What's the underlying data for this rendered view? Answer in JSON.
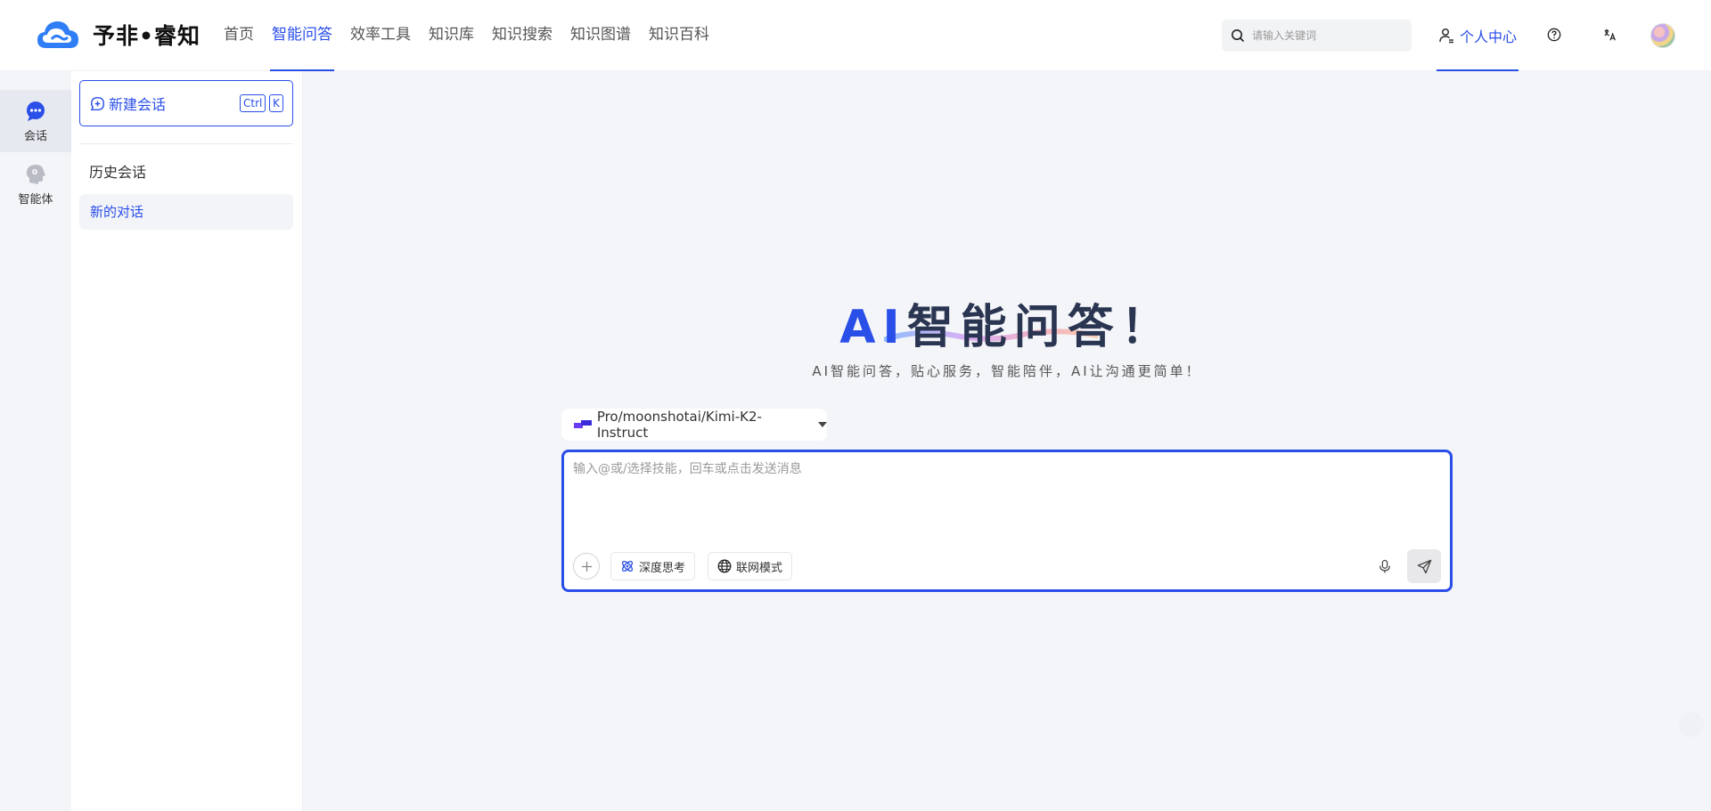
{
  "brand": {
    "name": "予非•睿知",
    "accent": "#2a4ee8"
  },
  "nav": {
    "items": [
      {
        "label": "首页",
        "active": false
      },
      {
        "label": "智能问答",
        "active": true
      },
      {
        "label": "效率工具",
        "active": false
      },
      {
        "label": "知识库",
        "active": false
      },
      {
        "label": "知识搜索",
        "active": false
      },
      {
        "label": "知识图谱",
        "active": false
      },
      {
        "label": "知识百科",
        "active": false
      }
    ]
  },
  "search": {
    "placeholder": "请输入关键词",
    "icon": "search-icon"
  },
  "header": {
    "user_center_label": "个人中心",
    "icons": [
      "help-icon",
      "translate-icon",
      "avatar"
    ]
  },
  "rail": {
    "items": [
      {
        "label": "会话",
        "icon": "chat-bubble-icon",
        "active": true
      },
      {
        "label": "智能体",
        "icon": "agent-head-icon",
        "active": false
      }
    ]
  },
  "panel": {
    "new_chat_label": "新建会话",
    "shortcut": {
      "key1": "Ctrl",
      "key2": "K"
    },
    "history_title": "历史会话",
    "history_items": [
      {
        "label": "新的对话",
        "active": true
      }
    ]
  },
  "hero": {
    "title_ai": "AI",
    "title_rest": "智能问答！",
    "subtitle": "AI智能问答，贴心服务，智能陪伴，AI让沟通更简单！"
  },
  "composer": {
    "model": "Pro/moonshotai/Kimi-K2-Instruct",
    "placeholder": "输入@或/选择技能，回车或点击发送消息",
    "deep_think_label": "深度思考",
    "web_mode_label": "联网模式"
  }
}
